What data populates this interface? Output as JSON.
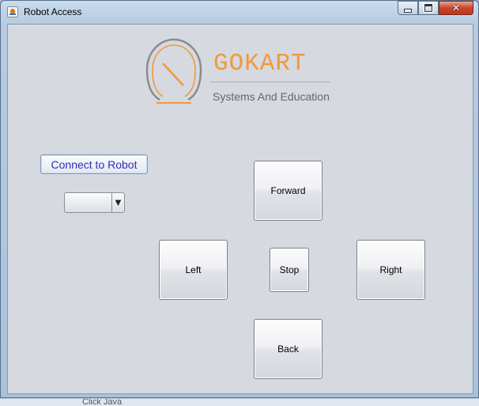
{
  "window": {
    "title": "Robot Access",
    "controls": {
      "minimize": "minimize",
      "maximize": "maximize",
      "close": "✕"
    }
  },
  "logo": {
    "name": "GOKART",
    "subtitle": "Systems And Education",
    "colors": {
      "accent": "#ef9a3c",
      "ring": "#8c8c8c",
      "line": "#8fb3d4"
    }
  },
  "connect": {
    "label": "Connect to Robot"
  },
  "port_select": {
    "value": "",
    "options": []
  },
  "controls": {
    "forward": "Forward",
    "left": "Left",
    "stop": "Stop",
    "right": "Right",
    "back": "Back"
  },
  "background_peek": {
    "text": "Click Java"
  }
}
